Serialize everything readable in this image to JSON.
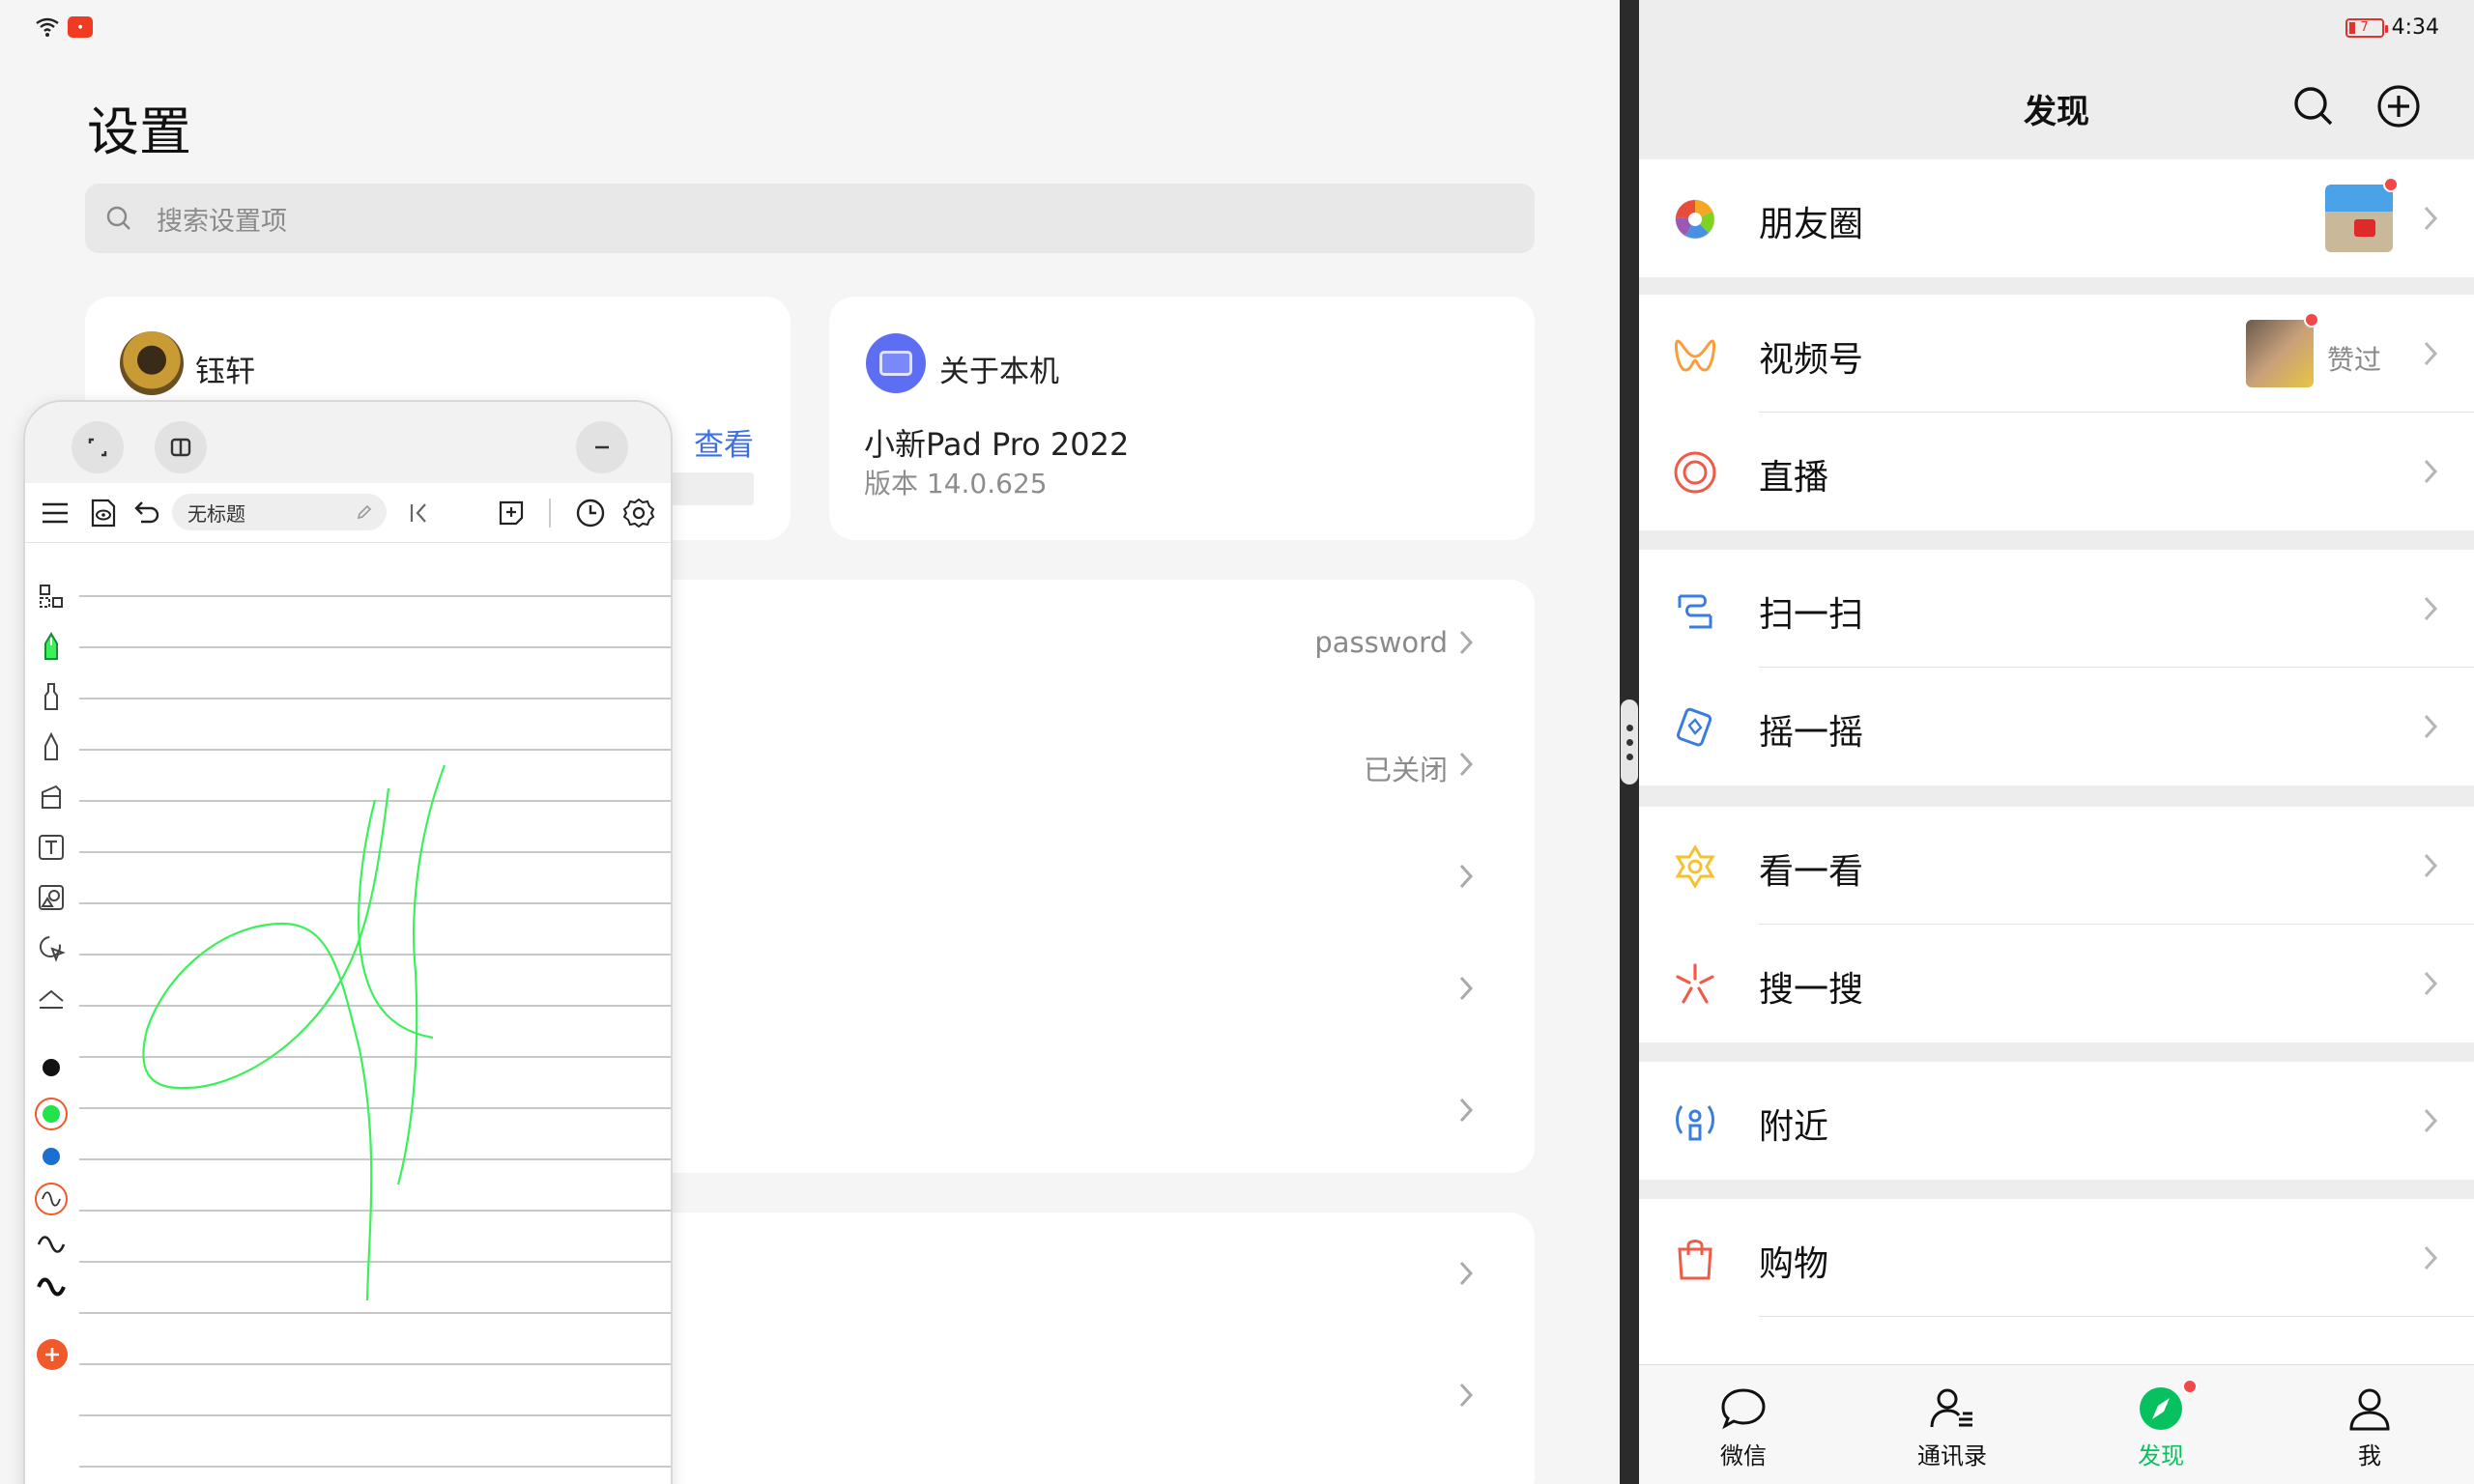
{
  "settings": {
    "title": "设置",
    "search_placeholder": "搜索设置项",
    "profile": {
      "name": "钰轩",
      "view_label": "查看"
    },
    "about": {
      "title": "关于本机",
      "device_name": "小新Pad Pro 2022",
      "version": "版本 14.0.625"
    },
    "rows": [
      {
        "value": "password"
      },
      {
        "value": "已关闭"
      },
      {
        "value": ""
      },
      {
        "value": ""
      },
      {
        "value": ""
      }
    ],
    "rows2": [
      {
        "value": ""
      },
      {
        "value": ""
      }
    ]
  },
  "notes": {
    "title_field": "无标题",
    "colors": {
      "black": "#111111",
      "green": "#22e34a",
      "blue": "#1a6fd0",
      "orange": "#f0592a",
      "ink": "#3cf05a"
    }
  },
  "wechat": {
    "status": {
      "battery": "7",
      "time": "4:34"
    },
    "title": "发现",
    "items": [
      {
        "label": "朋友圈",
        "icon": "moments-icon"
      },
      {
        "label": "视频号",
        "icon": "channels-icon",
        "sub": "赞过"
      },
      {
        "label": "直播",
        "icon": "live-icon"
      },
      {
        "label": "扫一扫",
        "icon": "scan-icon"
      },
      {
        "label": "摇一摇",
        "icon": "shake-icon"
      },
      {
        "label": "看一看",
        "icon": "top-stories-icon"
      },
      {
        "label": "搜一搜",
        "icon": "search-discover-icon"
      },
      {
        "label": "附近",
        "icon": "nearby-icon"
      },
      {
        "label": "购物",
        "icon": "shopping-icon"
      }
    ],
    "tabs": [
      {
        "label": "微信",
        "icon": "chat-icon"
      },
      {
        "label": "通讯录",
        "icon": "contacts-icon"
      },
      {
        "label": "发现",
        "icon": "discover-icon"
      },
      {
        "label": "我",
        "icon": "me-icon"
      }
    ],
    "accent": "#07c160"
  }
}
